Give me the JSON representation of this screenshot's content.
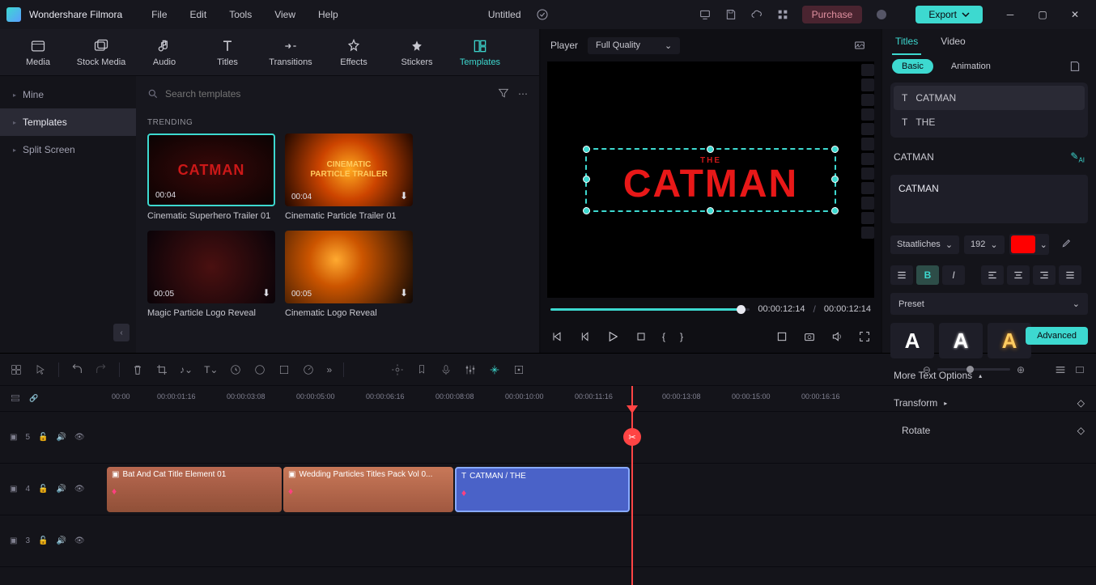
{
  "app": {
    "title": "Wondershare Filmora",
    "project": "Untitled"
  },
  "menu": [
    "File",
    "Edit",
    "Tools",
    "View",
    "Help"
  ],
  "titlebar": {
    "purchase": "Purchase",
    "export": "Export"
  },
  "tools": [
    {
      "label": "Media"
    },
    {
      "label": "Stock Media"
    },
    {
      "label": "Audio"
    },
    {
      "label": "Titles"
    },
    {
      "label": "Transitions"
    },
    {
      "label": "Effects"
    },
    {
      "label": "Stickers"
    },
    {
      "label": "Templates"
    }
  ],
  "sidebar": {
    "items": [
      "Mine",
      "Templates",
      "Split Screen"
    ]
  },
  "search": {
    "placeholder": "Search templates"
  },
  "section": {
    "trending": "TRENDING"
  },
  "cards": [
    {
      "time": "00:04",
      "title": "Cinematic Superhero Trailer 01",
      "txt": "CATMAN"
    },
    {
      "time": "00:04",
      "title": "Cinematic Particle Trailer 01",
      "txt1": "CINEMATIC",
      "txt2": "PARTICLE TRAILER"
    },
    {
      "time": "00:05",
      "title": "Magic Particle Logo Reveal"
    },
    {
      "time": "00:05",
      "title": "Cinematic Logo Reveal"
    }
  ],
  "player": {
    "label": "Player",
    "quality": "Full Quality",
    "the": "THE",
    "catman": "CATMAN",
    "current": "00:00:12:14",
    "total": "00:00:12:14",
    "sep": "/"
  },
  "inspector": {
    "tabs": [
      "Titles",
      "Video"
    ],
    "subtabs": [
      "Basic",
      "Animation"
    ],
    "layers": [
      "CATMAN",
      "THE"
    ],
    "edit_label": "CATMAN",
    "text_value": "CATMAN",
    "font": "Staatliches",
    "size": "192",
    "preset_label": "Preset",
    "more": "More Text Options",
    "transform": "Transform",
    "rotate": "Rotate",
    "advanced": "Advanced"
  },
  "ruler": [
    "00:00",
    "00:00:01:16",
    "00:00:03:08",
    "00:00:05:00",
    "00:00:06:16",
    "00:00:08:08",
    "00:00:10:00",
    "00:00:11:16",
    "00:00:13:08",
    "00:00:15:00",
    "00:00:16:16"
  ],
  "clips": [
    {
      "title": "Bat And Cat Title Element 01"
    },
    {
      "title": "Wedding Particles Titles Pack Vol 0..."
    },
    {
      "title": "CATMAN / THE"
    }
  ],
  "track_labels": {
    "t5": "5",
    "t4": "4",
    "t3": "3"
  }
}
